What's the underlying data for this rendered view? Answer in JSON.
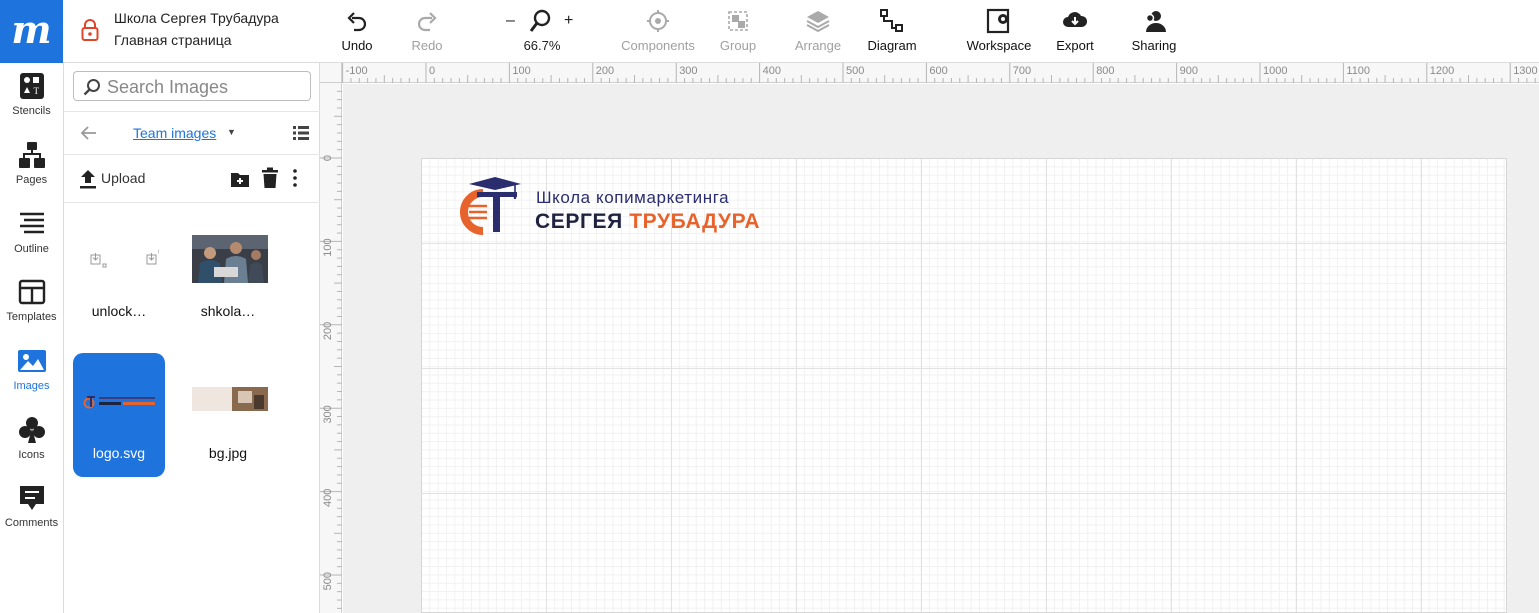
{
  "app": {
    "logo_letter": "m",
    "document_title": "Школа Сергея Трубадура",
    "page_name": "Главная страница"
  },
  "toolbar": {
    "undo": "Undo",
    "redo": "Redo",
    "zoom_minus": "–",
    "zoom_plus": "+",
    "zoom_level": "66.7%",
    "components": "Components",
    "group": "Group",
    "arrange": "Arrange",
    "diagram": "Diagram",
    "workspace": "Workspace",
    "export": "Export",
    "sharing": "Sharing"
  },
  "rail": {
    "items": [
      {
        "label": "Stencils",
        "icon": "stencils-icon"
      },
      {
        "label": "Pages",
        "icon": "pages-icon"
      },
      {
        "label": "Outline",
        "icon": "outline-icon"
      },
      {
        "label": "Templates",
        "icon": "templates-icon"
      },
      {
        "label": "Images",
        "icon": "images-icon",
        "active": true
      },
      {
        "label": "Icons",
        "icon": "club-icon"
      },
      {
        "label": "Comments",
        "icon": "comments-icon"
      }
    ]
  },
  "panel": {
    "search_placeholder": "Search Images",
    "folder": "Team images",
    "upload": "Upload",
    "images": [
      {
        "name": "unlock…"
      },
      {
        "name": "shkola…"
      },
      {
        "name": "logo.svg",
        "selected": true
      },
      {
        "name": "bg.jpg"
      }
    ]
  },
  "ruler": {
    "top_labels": [
      "-100",
      "0",
      "100",
      "200",
      "300",
      "400",
      "500",
      "600",
      "700",
      "800",
      "900",
      "1000",
      "1100",
      "1200",
      "1300"
    ],
    "left_labels": [
      "0",
      "100",
      "200",
      "300",
      "400",
      "500"
    ]
  },
  "canvas": {
    "brand_line1": "Школа копимаркетинга",
    "brand_line2_a": "СЕРГЕЯ ",
    "brand_line2_b": "ТРУБАДУРА",
    "colors": {
      "navy": "#2a2d6e",
      "orange": "#e8632b",
      "accent": "#1e74dc"
    }
  }
}
